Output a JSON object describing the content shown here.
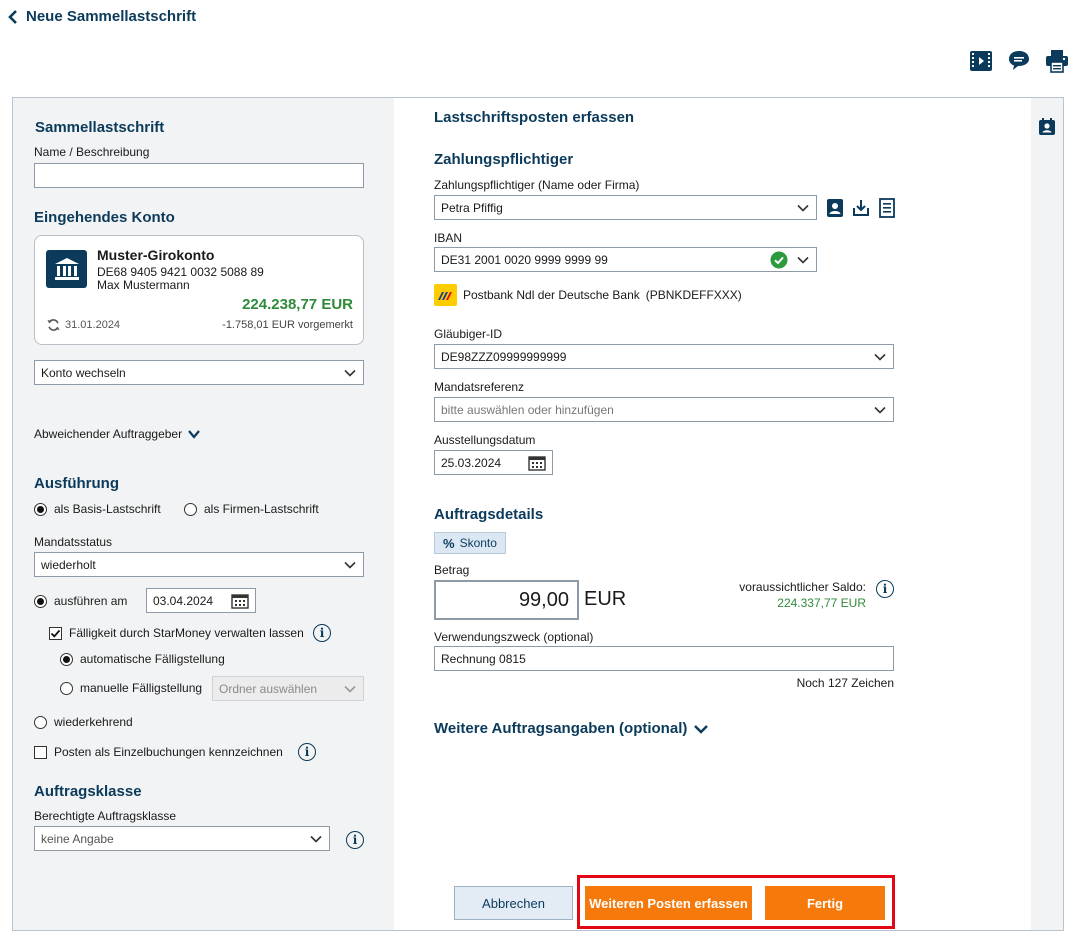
{
  "header": {
    "back_label": "Neue Sammellastschrift"
  },
  "top_icons": [
    "video-icon",
    "chat-icon",
    "print-icon"
  ],
  "left": {
    "sammel_title": "Sammellastschrift",
    "name_label": "Name / Beschreibung",
    "name_value": "",
    "konto_title": "Eingehendes Konto",
    "account": {
      "name": "Muster-Girokonto",
      "iban": "DE68 9405 9421 0032 5088 89",
      "owner": "Max Mustermann",
      "balance": "224.238,77 EUR",
      "date": "31.01.2024",
      "pending": "-1.758,01 EUR vorgemerkt"
    },
    "switch_account": "Konto wechseln",
    "different_payer": "Abweichender Auftraggeber",
    "exec_title": "Ausführung",
    "radio_basis": "als Basis-Lastschrift",
    "radio_firmen": "als Firmen-Lastschrift",
    "mandate_status_label": "Mandatsstatus",
    "mandate_status_value": "wiederholt",
    "execute_on_label": "ausführen am",
    "execute_on_date": "03.04.2024",
    "due_manage_label": "Fälligkeit durch StarMoney verwalten lassen",
    "auto_due": "automatische Fälligstellung",
    "manual_due": "manuelle Fälligstellung",
    "folder_placeholder": "Ordner auswählen",
    "recurring": "wiederkehrend",
    "single_bookings": "Posten als Einzelbuchungen kennzeichnen",
    "class_title": "Auftragsklasse",
    "class_label": "Berechtigte Auftragsklasse",
    "class_value": "keine Angabe"
  },
  "main": {
    "title": "Lastschriftsposten erfassen",
    "payer_title": "Zahlungspflichtiger",
    "payer_label": "Zahlungspflichtiger (Name oder Firma)",
    "payer_value": "Petra Pfiffig",
    "iban_label": "IBAN",
    "iban_value": "DE31 2001 0020 9999 9999 99",
    "bank_name": "Postbank Ndl der Deutsche Bank",
    "bic": "(PBNKDEFFXXX)",
    "creditor_label": "Gläubiger-ID",
    "creditor_value": "DE98ZZZ09999999999",
    "mandate_label": "Mandatsreferenz",
    "mandate_placeholder": "bitte auswählen oder hinzufügen",
    "issue_date_label": "Ausstellungsdatum",
    "issue_date_value": "25.03.2024",
    "details_title": "Auftragsdetails",
    "skonto_label": "Skonto",
    "amount_label": "Betrag",
    "amount_value": "99,00",
    "currency": "EUR",
    "expected_balance_label": "voraussichtlicher Saldo:",
    "expected_balance_value": "224.337,77 EUR",
    "purpose_label": "Verwendungszweck (optional)",
    "purpose_value": "Rechnung 0815",
    "chars_left": "Noch 127 Zeichen",
    "more_details": "Weitere Auftragsangaben (optional)"
  },
  "buttons": {
    "cancel": "Abbrechen",
    "add_more": "Weiteren Posten erfassen",
    "done": "Fertig"
  },
  "colors": {
    "navy": "#0b3a5b",
    "orange": "#f57a0b",
    "green": "#2e8b3a",
    "highlight": "#e30613"
  }
}
